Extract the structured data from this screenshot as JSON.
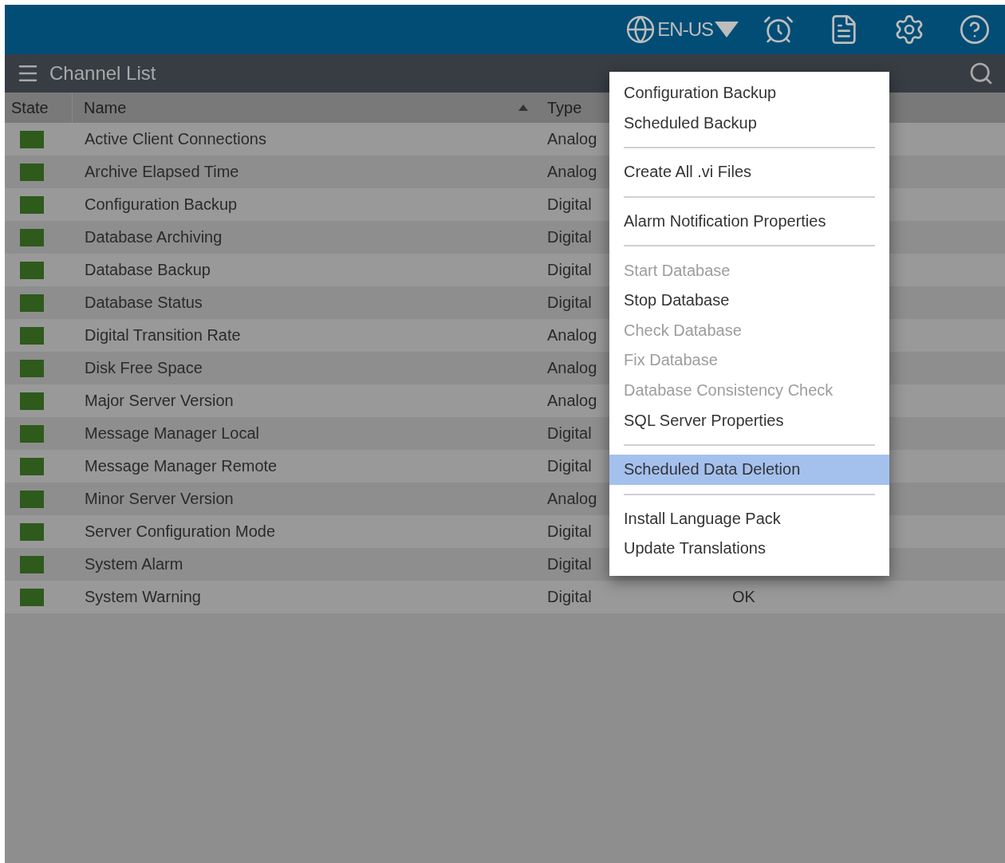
{
  "top_bar": {
    "language": "EN-US"
  },
  "panel": {
    "title": "Channel List"
  },
  "table": {
    "columns": [
      {
        "label": "State"
      },
      {
        "label": "Name",
        "sorted_ascending": true
      },
      {
        "label": "Type"
      }
    ],
    "rows": [
      {
        "name": "Active Client Connections",
        "type": "Analog",
        "color": "#2e5a1c"
      },
      {
        "name": "Archive Elapsed Time",
        "type": "Analog",
        "color": "#2e5a1c"
      },
      {
        "name": "Configuration Backup",
        "type": "Digital",
        "color": "#2e5a1c"
      },
      {
        "name": "Database Archiving",
        "type": "Digital",
        "color": "#2e5a1c"
      },
      {
        "name": "Database Backup",
        "type": "Digital",
        "color": "#2e5a1c"
      },
      {
        "name": "Database Status",
        "type": "Digital",
        "color": "#2e5a1c"
      },
      {
        "name": "Digital Transition Rate",
        "type": "Analog",
        "color": "#2e5a1c"
      },
      {
        "name": "Disk Free Space",
        "type": "Analog",
        "color": "#2e5a1c"
      },
      {
        "name": "Major Server Version",
        "type": "Analog",
        "color": "#2e5a1c"
      },
      {
        "name": "Message Manager Local",
        "type": "Digital",
        "color": "#2e5a1c"
      },
      {
        "name": "Message Manager Remote",
        "type": "Digital",
        "color": "#2e5a1c"
      },
      {
        "name": "Minor Server Version",
        "type": "Analog",
        "color": "#2e5a1c"
      },
      {
        "name": "Server Configuration Mode",
        "type": "Digital",
        "color": "#2e5a1c"
      },
      {
        "name": "System Alarm",
        "type": "Digital",
        "color": "#2e5a1c"
      },
      {
        "name": "System Warning",
        "type": "Digital",
        "color": "#2e5a1c",
        "value": "OK"
      }
    ]
  },
  "menu": {
    "groups": [
      {
        "items": [
          {
            "label": "Configuration Backup",
            "disabled": false,
            "selected": false
          },
          {
            "label": "Scheduled Backup",
            "disabled": false,
            "selected": false
          }
        ]
      },
      {
        "items": [
          {
            "label": "Create All .vi Files",
            "disabled": false,
            "selected": false
          }
        ]
      },
      {
        "items": [
          {
            "label": "Alarm Notification Properties",
            "disabled": false,
            "selected": false
          }
        ]
      },
      {
        "items": [
          {
            "label": "Start Database",
            "disabled": true,
            "selected": false
          },
          {
            "label": "Stop Database",
            "disabled": false,
            "selected": false
          },
          {
            "label": "Check Database",
            "disabled": true,
            "selected": false
          },
          {
            "label": "Fix Database",
            "disabled": true,
            "selected": false
          },
          {
            "label": "Database Consistency Check",
            "disabled": true,
            "selected": false
          },
          {
            "label": "SQL Server Properties",
            "disabled": false,
            "selected": false
          }
        ]
      },
      {
        "items": [
          {
            "label": "Scheduled Data Deletion",
            "disabled": false,
            "selected": true
          }
        ]
      },
      {
        "items": [
          {
            "label": "Install Language Pack",
            "disabled": false,
            "selected": false
          },
          {
            "label": "Update Translations",
            "disabled": false,
            "selected": false
          }
        ]
      }
    ]
  }
}
